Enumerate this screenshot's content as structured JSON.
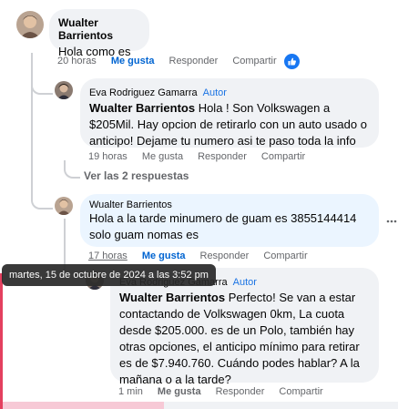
{
  "comments": [
    {
      "author": "Wualter Barrientos",
      "text": "Hola como es",
      "time": "20 horas",
      "like": "Me gusta",
      "reply": "Responder",
      "share": "Compartir"
    },
    {
      "author": "Eva Rodriguez Gamarra",
      "badge": "Autor",
      "mention": "Wualter Barrientos",
      "text": " Hola ! Son Volkswagen a $205Mil. Hay opcion de retirarlo con un auto usado o anticipo! Dejame tu numero asi te paso toda la info",
      "time": "19 horas",
      "like": "Me gusta",
      "reply": "Responder",
      "share": "Compartir",
      "replies_link": "Ver las 2 respuestas"
    },
    {
      "author": "Wualter Barrientos",
      "text": "Hola a la tarde minumero de guam es 3855144414 solo guam nomas es",
      "time": "17 horas",
      "like": "Me gusta",
      "reply": "Responder",
      "share": "Compartir"
    },
    {
      "author": "Eva Rodriguez Gamarra",
      "badge": "Autor",
      "mention": "Wualter Barrientos",
      "text": " Perfecto! Se van a estar contactando de Volkswagen 0km, La cuota desde $205.000. es de un Polo, también hay otras opciones, el anticipo mínimo para retirar es de $7.940.760. Cuándo podes hablar? A la mañana o a la tarde?",
      "time": "1 min",
      "like": "Me gusta",
      "reply": "Responder",
      "share": "Compartir"
    }
  ],
  "tooltip": "martes, 15 de octubre de 2024 a las 3:52 pm",
  "more_icon": "ellipsis-icon",
  "reaction_icon": "like-reaction-icon",
  "colors": {
    "link_blue": "#0064d1",
    "author_badge": "#1b74e4",
    "bubble": "#f0f2f5",
    "bubble_highlight": "#ebf5ff"
  }
}
